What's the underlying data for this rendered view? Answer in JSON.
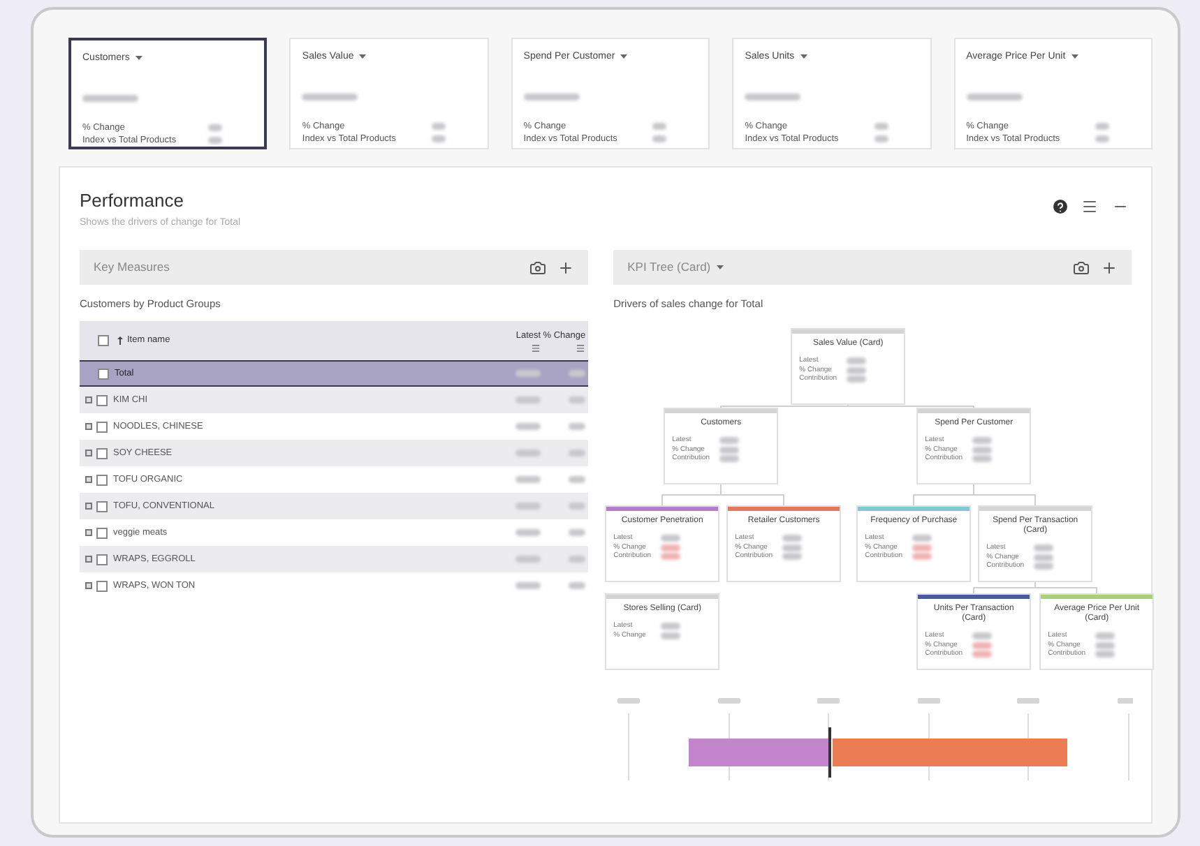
{
  "kpi_cards": [
    {
      "title": "Customers",
      "selected": true,
      "rows": [
        "% Change",
        "Index vs Total Products"
      ]
    },
    {
      "title": "Sales Value",
      "selected": false,
      "rows": [
        "% Change",
        "Index vs Total Products"
      ]
    },
    {
      "title": "Spend Per Customer",
      "selected": false,
      "rows": [
        "% Change",
        "Index vs Total Products"
      ]
    },
    {
      "title": "Sales Units",
      "selected": false,
      "rows": [
        "% Change",
        "Index vs Total Products"
      ]
    },
    {
      "title": "Average Price Per Unit",
      "selected": false,
      "rows": [
        "% Change",
        "Index vs Total Products"
      ]
    }
  ],
  "performance": {
    "title": "Performance",
    "subtitle": "Shows the drivers of change for Total",
    "left": {
      "header": "Key Measures",
      "subtitle": "Customers by Product Groups",
      "table": {
        "columns": [
          "Item name",
          "Latest",
          "% Change"
        ],
        "select_all_checked": false,
        "rows": [
          {
            "name": "Total",
            "kind": "total",
            "checked": false
          },
          {
            "name": "KIM CHI",
            "kind": "group",
            "checked": false
          },
          {
            "name": "NOODLES, CHINESE",
            "kind": "group",
            "checked": false
          },
          {
            "name": "SOY CHEESE",
            "kind": "group",
            "checked": false
          },
          {
            "name": "TOFU ORGANIC",
            "kind": "group",
            "checked": false
          },
          {
            "name": "TOFU, CONVENTIONAL",
            "kind": "group",
            "checked": false
          },
          {
            "name": "veggie meats",
            "kind": "group",
            "checked": false
          },
          {
            "name": "WRAPS, EGGROLL",
            "kind": "group",
            "checked": false
          },
          {
            "name": "WRAPS, WON TON",
            "kind": "group",
            "checked": false
          }
        ]
      }
    },
    "right": {
      "header": "KPI Tree (Card)",
      "subtitle": "Drivers of sales change for Total",
      "nodes": [
        {
          "title": "Sales Value (Card)",
          "color": "#d4d4d4",
          "metrics": [
            {
              "label": "Latest"
            },
            {
              "label": "% Change"
            },
            {
              "label": "Contribution"
            }
          ],
          "children": [
            {
              "title": "Customers",
              "color": "#d4d4d4",
              "metrics": [
                {
                  "label": "Latest"
                },
                {
                  "label": "% Change"
                },
                {
                  "label": "Contribution"
                }
              ],
              "children": [
                {
                  "title": "Customer Penetration",
                  "color": "#b57cc9",
                  "metrics": [
                    {
                      "label": "Latest"
                    },
                    {
                      "label": "% Change",
                      "negative": true
                    },
                    {
                      "label": "Contribution",
                      "negative": true
                    }
                  ]
                },
                {
                  "title": "Retailer Customers",
                  "color": "#e07a5f",
                  "metrics": [
                    {
                      "label": "Latest"
                    },
                    {
                      "label": "% Change"
                    },
                    {
                      "label": "Contribution"
                    }
                  ]
                }
              ]
            },
            {
              "title": "Spend Per Customer",
              "color": "#d4d4d4",
              "metrics": [
                {
                  "label": "Latest"
                },
                {
                  "label": "% Change"
                },
                {
                  "label": "Contribution"
                }
              ],
              "children": [
                {
                  "title": "Frequency of Purchase",
                  "color": "#7ec8d8",
                  "metrics": [
                    {
                      "label": "Latest"
                    },
                    {
                      "label": "% Change",
                      "negative": true
                    },
                    {
                      "label": "Contribution",
                      "negative": true
                    }
                  ]
                },
                {
                  "title": "Spend Per Transaction (Card)",
                  "color": "#d4d4d4",
                  "metrics": [
                    {
                      "label": "Latest"
                    },
                    {
                      "label": "% Change"
                    },
                    {
                      "label": "Contribution"
                    }
                  ],
                  "children": [
                    {
                      "title": "Units Per Transaction (Card)",
                      "color": "#4a5a9a",
                      "metrics": [
                        {
                          "label": "Latest"
                        },
                        {
                          "label": "% Change",
                          "negative": true
                        },
                        {
                          "label": "Contribution",
                          "negative": true
                        }
                      ]
                    },
                    {
                      "title": "Average Price Per Unit (Card)",
                      "color": "#a9cf7a",
                      "metrics": [
                        {
                          "label": "Latest"
                        },
                        {
                          "label": "% Change"
                        },
                        {
                          "label": "Contribution"
                        }
                      ]
                    }
                  ]
                }
              ]
            }
          ]
        },
        {
          "title": "Stores Selling (Card)",
          "color": "#d4d4d4",
          "metrics": [
            {
              "label": "Latest"
            },
            {
              "label": "% Change"
            }
          ]
        }
      ]
    }
  }
}
